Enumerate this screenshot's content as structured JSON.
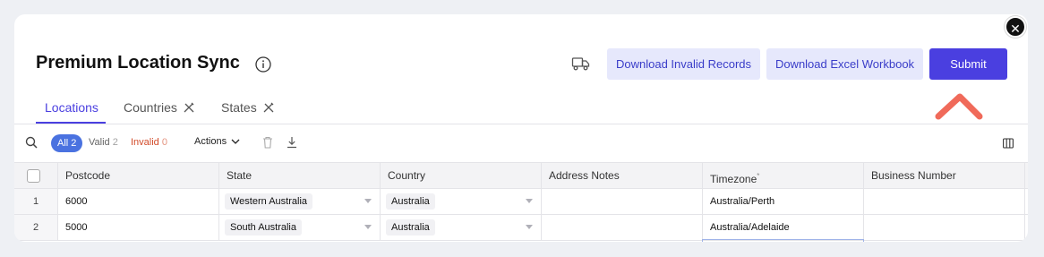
{
  "page": {
    "title": "Premium Location Sync"
  },
  "header_buttons": {
    "download_invalid": "Download Invalid Records",
    "download_workbook": "Download Excel Workbook",
    "submit": "Submit"
  },
  "tabs": [
    {
      "label": "Locations",
      "active": true
    },
    {
      "label": "Countries",
      "active": false
    },
    {
      "label": "States",
      "active": false
    }
  ],
  "filters": {
    "all": {
      "label": "All",
      "count": "2"
    },
    "valid": {
      "label": "Valid",
      "count": "2"
    },
    "invalid": {
      "label": "Invalid",
      "count": "0"
    },
    "actions_label": "Actions"
  },
  "columns": [
    "Postcode",
    "State",
    "Country",
    "Address Notes",
    "Timezone",
    "Business Number"
  ],
  "required_marker": "*",
  "rows": [
    {
      "num": "1",
      "postcode": "6000",
      "state": "Western Australia",
      "country": "Australia",
      "notes": "",
      "timezone": "Australia/Perth",
      "business_number": ""
    },
    {
      "num": "2",
      "postcode": "5000",
      "state": "South Australia",
      "country": "Australia",
      "notes": "",
      "timezone": "Australia/Adelaide",
      "business_number": ""
    }
  ],
  "colors": {
    "accent": "#4a3fe0",
    "pill": "#4a72e0",
    "invalid": "#d24b2a",
    "annotation": "#f06a5a"
  }
}
